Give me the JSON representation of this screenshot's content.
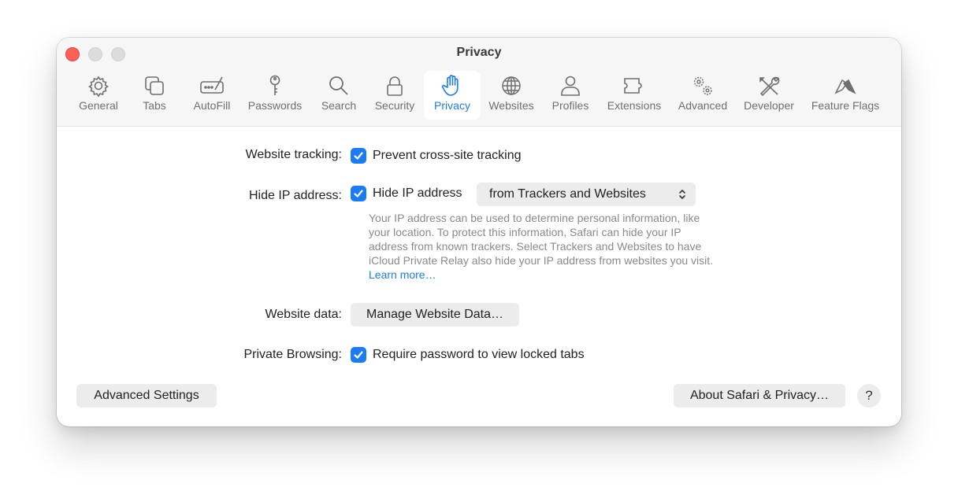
{
  "window": {
    "title": "Privacy"
  },
  "toolbar": {
    "items": [
      {
        "label": "General",
        "icon": "gear-icon"
      },
      {
        "label": "Tabs",
        "icon": "tabs-icon"
      },
      {
        "label": "AutoFill",
        "icon": "autofill-icon"
      },
      {
        "label": "Passwords",
        "icon": "key-icon"
      },
      {
        "label": "Search",
        "icon": "search-icon"
      },
      {
        "label": "Security",
        "icon": "lock-icon"
      },
      {
        "label": "Privacy",
        "icon": "hand-icon",
        "active": true
      },
      {
        "label": "Websites",
        "icon": "globe-icon"
      },
      {
        "label": "Profiles",
        "icon": "person-icon"
      },
      {
        "label": "Extensions",
        "icon": "puzzle-icon"
      },
      {
        "label": "Advanced",
        "icon": "gears-icon"
      },
      {
        "label": "Developer",
        "icon": "tools-icon"
      },
      {
        "label": "Feature Flags",
        "icon": "flags-icon"
      }
    ]
  },
  "settings": {
    "website_tracking": {
      "label": "Website tracking:",
      "checkbox_label": "Prevent cross-site tracking",
      "checked": true
    },
    "hide_ip": {
      "label": "Hide IP address:",
      "checkbox_label": "Hide IP address",
      "checked": true,
      "popup_value": "from Trackers and Websites",
      "help_text": "Your IP address can be used to determine personal information, like your location. To protect this information, Safari can hide your IP address from known trackers. Select Trackers and Websites to have iCloud Private Relay also hide your IP address from websites you visit.",
      "learn_more": "Learn more…"
    },
    "website_data": {
      "label": "Website data:",
      "button_label": "Manage Website Data…"
    },
    "private_browsing": {
      "label": "Private Browsing:",
      "checkbox_label": "Require password to view locked tabs",
      "checked": true
    }
  },
  "footer": {
    "advanced_settings": "Advanced Settings",
    "about_privacy": "About Safari & Privacy…",
    "help": "?"
  },
  "colors": {
    "accent": "#1a7cf5",
    "close": "#fe5f57"
  }
}
